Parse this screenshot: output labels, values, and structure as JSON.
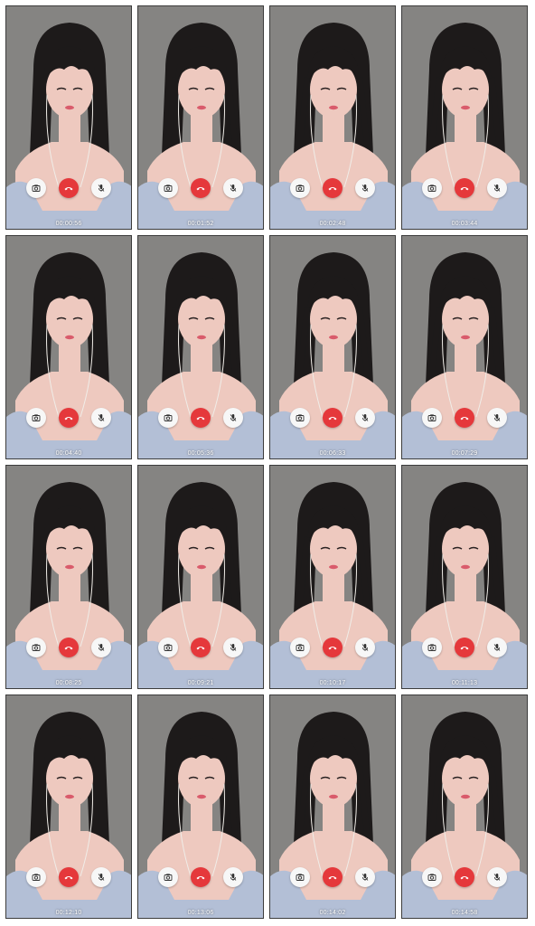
{
  "theme": {
    "background": "#ffffff",
    "tile_border": "#3c3c3c",
    "end_call_color": "#e5383b",
    "button_color": "#f7f7f7",
    "wall_color": "#858482",
    "hair_color": "#1d1a1a",
    "skin_color": "#eec9bf",
    "top_color": "#b3bfd6",
    "earphone_color": "#f0ede8"
  },
  "controls": {
    "left_icon": "camera-icon",
    "center_icon": "end-call-icon",
    "right_icon": "mic-icon"
  },
  "frames": [
    {
      "timestamp": "00:00:56"
    },
    {
      "timestamp": "00:01:52"
    },
    {
      "timestamp": "00:02:48"
    },
    {
      "timestamp": "00:03:44"
    },
    {
      "timestamp": "00:04:40"
    },
    {
      "timestamp": "00:05:36"
    },
    {
      "timestamp": "00:06:33"
    },
    {
      "timestamp": "00:07:29"
    },
    {
      "timestamp": "00:08:25"
    },
    {
      "timestamp": "00:09:21"
    },
    {
      "timestamp": "00:10:17"
    },
    {
      "timestamp": "00:11:13"
    },
    {
      "timestamp": "00:12:10"
    },
    {
      "timestamp": "00:13:06"
    },
    {
      "timestamp": "00:14:02"
    },
    {
      "timestamp": "00:14:58"
    }
  ]
}
